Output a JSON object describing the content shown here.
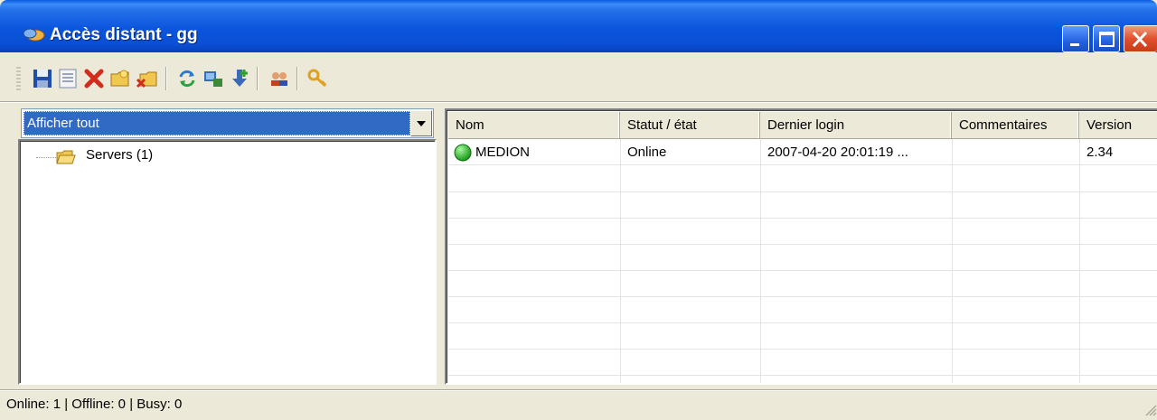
{
  "window": {
    "title": "Accès distant - gg",
    "icon": "remote-access-icon"
  },
  "title_buttons": {
    "minimize": "minimize-icon",
    "maximize": "maximize-icon",
    "close": "close-icon"
  },
  "toolbar": {
    "items": [
      {
        "name": "save-icon",
        "color": "#1f4fa8"
      },
      {
        "name": "properties-icon",
        "color": "#7c8aa8"
      },
      {
        "name": "delete-icon",
        "color": "#d22c1c"
      },
      {
        "name": "new-folder-icon",
        "color": "#e8b83c"
      },
      {
        "name": "delete-folder-icon",
        "color": "#e8b83c"
      },
      {
        "name": "refresh-icon",
        "color": "#2a7ad0"
      },
      {
        "name": "connect-icon",
        "color": "#3a6ab8"
      },
      {
        "name": "add-server-icon",
        "color": "#3a8a3a"
      },
      {
        "name": "users-icon",
        "color": "#c04020"
      },
      {
        "name": "key-icon",
        "color": "#e0a020"
      }
    ]
  },
  "filter": {
    "selected": "Afficher tout"
  },
  "tree": {
    "root": {
      "label": "Servers (1)",
      "icon": "folder-icon"
    }
  },
  "list": {
    "columns": [
      "Nom",
      "Statut / état",
      "Dernier login",
      "Commentaires",
      "Version"
    ],
    "rows": [
      {
        "status_icon": "online-status-icon",
        "status_color": "#2ec02e",
        "name": "MEDION",
        "status": "Online",
        "last_login": "2007-04-20 20:01:19 ...",
        "comments": "",
        "version": "2.34"
      }
    ]
  },
  "statusbar": {
    "text": "Online: 1 | Offline: 0 | Busy: 0"
  }
}
